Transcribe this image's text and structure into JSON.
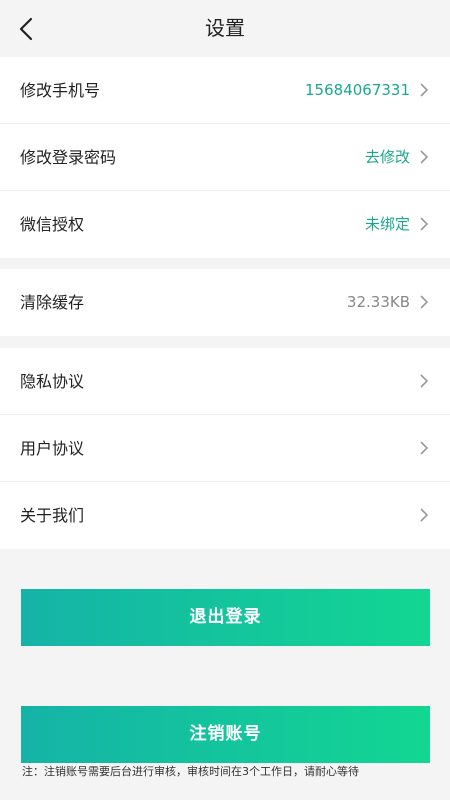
{
  "header": {
    "title": "设置"
  },
  "account": [
    {
      "label": "修改手机号",
      "value": "15684067331"
    },
    {
      "label": "修改登录密码",
      "value": "去修改"
    },
    {
      "label": "微信授权",
      "value": "未绑定"
    }
  ],
  "cache": {
    "label": "清除缓存",
    "value": "32.33KB"
  },
  "about": [
    {
      "label": "隐私协议"
    },
    {
      "label": "用户协议"
    },
    {
      "label": "关于我们"
    }
  ],
  "buttons": {
    "logout": "退出登录",
    "cancel_account": "注销账号"
  },
  "note": "注：注销账号需要后台进行审核，审核时间在3个工作日，请耐心等待",
  "colors": {
    "accent": "#1aa88e",
    "gradient_start": "#15b3a7",
    "gradient_end": "#12d692"
  }
}
